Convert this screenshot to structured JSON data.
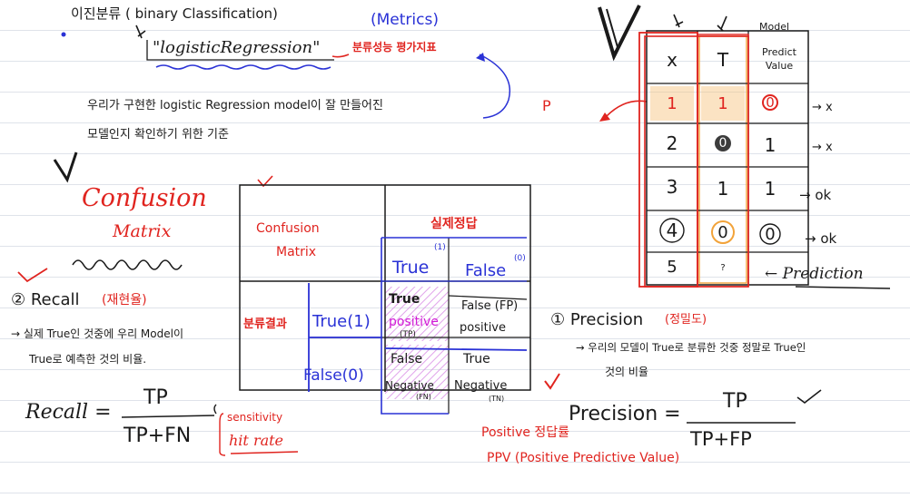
{
  "header": {
    "title": "이진분류 ( binary Classification)",
    "metrics": "(Metrics)",
    "lr_name": "\"logisticRegression\"",
    "lr_note": "분류성능 평가지표"
  },
  "intro": {
    "line1": "우리가 구현한 logistic Regression model이 잘 만들어진",
    "line2": "모델인지 확인하기 위한 기준",
    "p_mark": "P"
  },
  "confusion_title": {
    "line1": "Confusion",
    "line2": "Matrix"
  },
  "matrix": {
    "corner_line1": "Confusion",
    "corner_line2": "Matrix",
    "actual_header": "실제정답",
    "pred_header": "분류결과",
    "actual_true": "True",
    "actual_true_sup": "(1)",
    "actual_false": "False",
    "actual_false_sup": "(0)",
    "pred_true": "True(1)",
    "pred_false": "False(0)",
    "tp_line1": "True",
    "tp_line2": "positive",
    "tp_line3": "(TP)",
    "fp_line1": "False (FP)",
    "fp_line2": "positive",
    "fn_line1": "False",
    "fn_line2": "Negative",
    "fn_line3": "(FN)",
    "tn_line1": "True",
    "tn_line2": "Negative",
    "tn_line3": "(TN)"
  },
  "recall": {
    "heading": "② Recall",
    "korean": "(재현율)",
    "desc1": "→ 실제 True인 것중에 우리 Model이",
    "desc2": "True로 예측한 것의 비율.",
    "lhs": "Recall =",
    "num": "TP",
    "den": "TP+FN",
    "alias1": "sensitivity",
    "alias2": "hit rate"
  },
  "precision": {
    "heading": "① Precision",
    "korean": "(정밀도)",
    "desc1": "→ 우리의 모델이 True로 분류한 것중 정말로 True인",
    "desc2": "것의 비율",
    "lhs": "Precision =",
    "num": "TP",
    "den": "TP+FP",
    "alias1": "Positive 정답률",
    "alias2": "PPV (Positive Predictive Value)"
  },
  "table": {
    "model_label": "Model",
    "headers": [
      "x",
      "T",
      "Predict Value"
    ],
    "rows": [
      {
        "x": "1",
        "t": "1",
        "p": "0",
        "result": "→ x"
      },
      {
        "x": "2",
        "t": "0",
        "p": "1",
        "result": "→ x"
      },
      {
        "x": "3",
        "t": "1",
        "p": "1",
        "result": "→ ok"
      },
      {
        "x": "4",
        "t": "0",
        "p": "0",
        "result": "→ ok"
      },
      {
        "x": "5",
        "t": "?",
        "p": "",
        "result": ""
      }
    ],
    "prediction_label": "← Prediction"
  },
  "colors": {
    "red": "#e0241f",
    "blue": "#2a32d6",
    "magenta": "#d21bd6",
    "orange": "#f2a33a"
  }
}
